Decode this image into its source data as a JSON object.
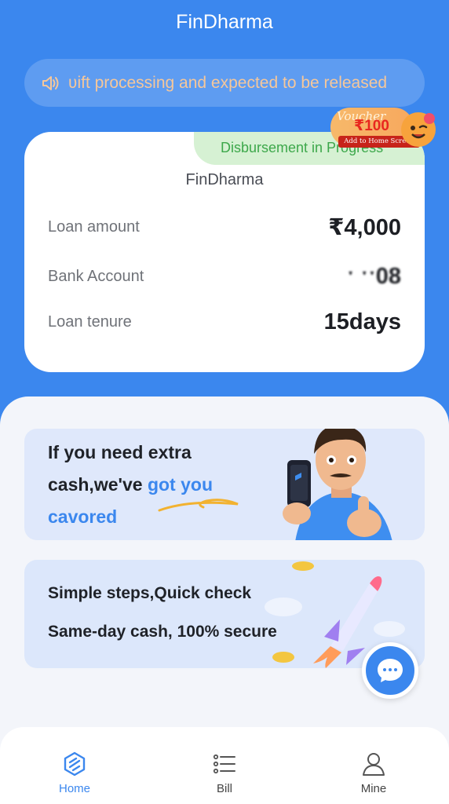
{
  "app": {
    "title": "FinDharma"
  },
  "notice": {
    "text": "ʋift processing and expected to be released"
  },
  "voucher": {
    "word": "Voucher",
    "amount": "₹100",
    "subtitle": "Add to Home Screen"
  },
  "loan_card": {
    "status": "Disbursement in Progress",
    "lender": "FinDharma",
    "rows": [
      {
        "label": "Loan amount",
        "value": "₹4,000"
      },
      {
        "label": "Bank Account",
        "value": "ˑ ˑˑ08"
      },
      {
        "label": "Loan tenure",
        "value": "15days"
      }
    ]
  },
  "promos": {
    "extra_cash": {
      "line1": "If you need extra",
      "line2a": "cash,we've ",
      "line2b": "got you",
      "line3": "cavored"
    },
    "steps": {
      "line1": "Simple steps,Quick check",
      "line2": "Same-day cash, 100% secure"
    }
  },
  "tabs": [
    {
      "label": "Home",
      "icon": "home-icon",
      "active": true
    },
    {
      "label": "Bill",
      "icon": "bill-list-icon",
      "active": false
    },
    {
      "label": "Mine",
      "icon": "user-icon",
      "active": false
    }
  ],
  "colors": {
    "primary": "#3b87ee",
    "status_green": "#3da84b",
    "notice_text": "#f6c79a"
  }
}
